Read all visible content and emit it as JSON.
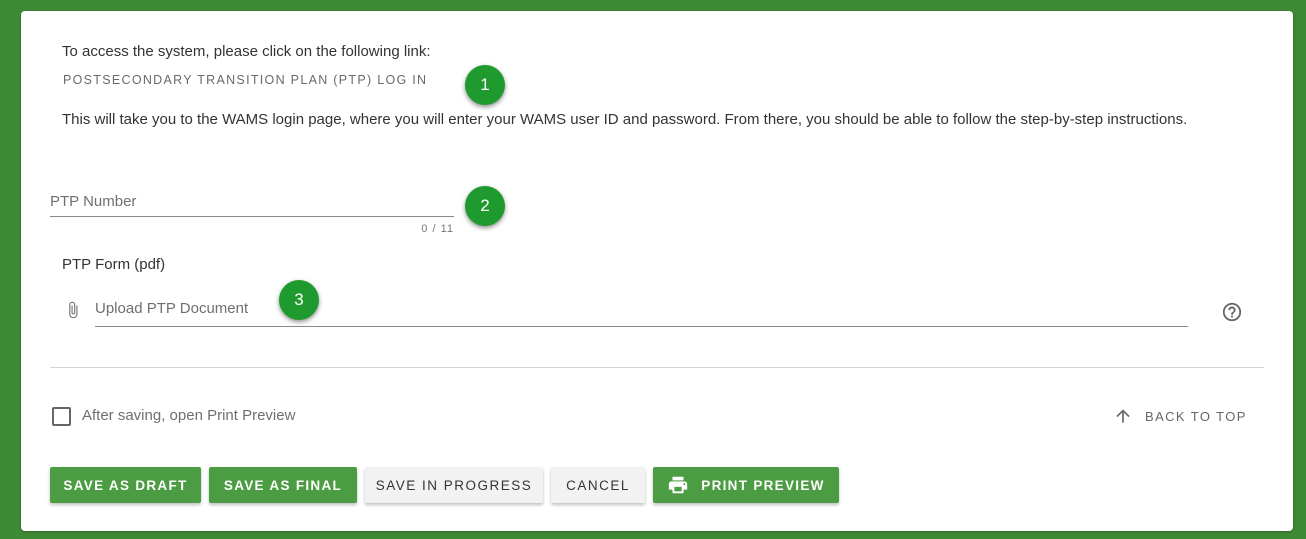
{
  "intro_text": "To access the system, please click on the following link:",
  "ptp_link_label": "POSTSECONDARY TRANSITION PLAN (PTP) LOG IN",
  "description": "This will take you to the WAMS login page, where you will enter your WAMS user ID and password. From there, you should be able to follow the step-by-step instructions.",
  "ptp_number": {
    "placeholder": "PTP Number",
    "value": "",
    "counter": "0 / 11"
  },
  "ptp_form": {
    "label": "PTP Form (pdf)",
    "upload_placeholder": "Upload PTP Document"
  },
  "badges": [
    "1",
    "2",
    "3"
  ],
  "print_preview_option": {
    "label": "After saving, open Print Preview",
    "checked": false
  },
  "back_to_top": "BACK TO TOP",
  "buttons": {
    "save_draft": "SAVE AS DRAFT",
    "save_final": "SAVE AS FINAL",
    "save_in_progress": "SAVE IN PROGRESS",
    "cancel": "CANCEL",
    "print_preview": "PRINT PREVIEW"
  },
  "colors": {
    "background": "#3f8a35",
    "primary_button": "#4c9c43",
    "badge": "#1e9a2e"
  },
  "icons": [
    "paperclip-icon",
    "help-circle-icon",
    "arrow-up-icon",
    "printer-icon"
  ]
}
